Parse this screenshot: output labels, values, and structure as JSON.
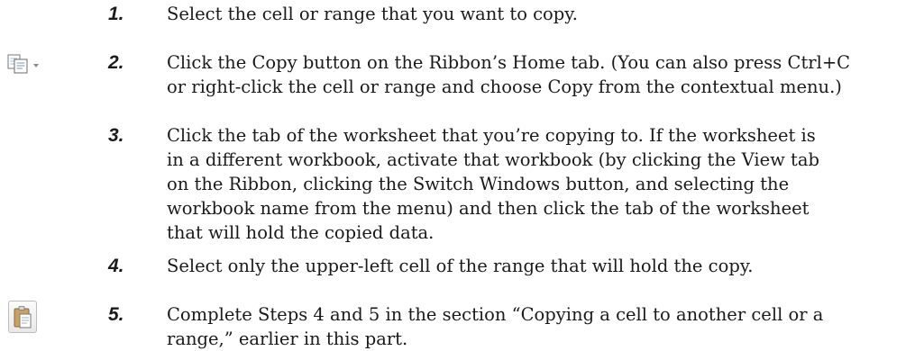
{
  "steps": [
    {
      "num": "1.",
      "text": "Select the cell or range that you want to copy."
    },
    {
      "num": "2.",
      "text": "Click the Copy button on the Ribbon’s Home tab. (You can also press Ctrl+C\nor right-click the cell or range and choose Copy from the contextual menu.)",
      "icon": "copy-icon"
    },
    {
      "num": "3.",
      "text": "Click the tab of the worksheet that you’re copying to. If the worksheet is\nin a different workbook, activate that workbook (by clicking the View tab\non the Ribbon, clicking the Switch Windows button, and selecting the\nworkbook name from the menu) and then click the tab of the worksheet\nthat will hold the copied data."
    },
    {
      "num": "4.",
      "text": "Select only the upper-left cell of the range that will hold the copy."
    },
    {
      "num": "5.",
      "text": "Complete Steps 4 and 5 in the section “Copying a cell to another cell or a\nrange,” earlier in this part.",
      "icon": "paste-icon"
    }
  ]
}
